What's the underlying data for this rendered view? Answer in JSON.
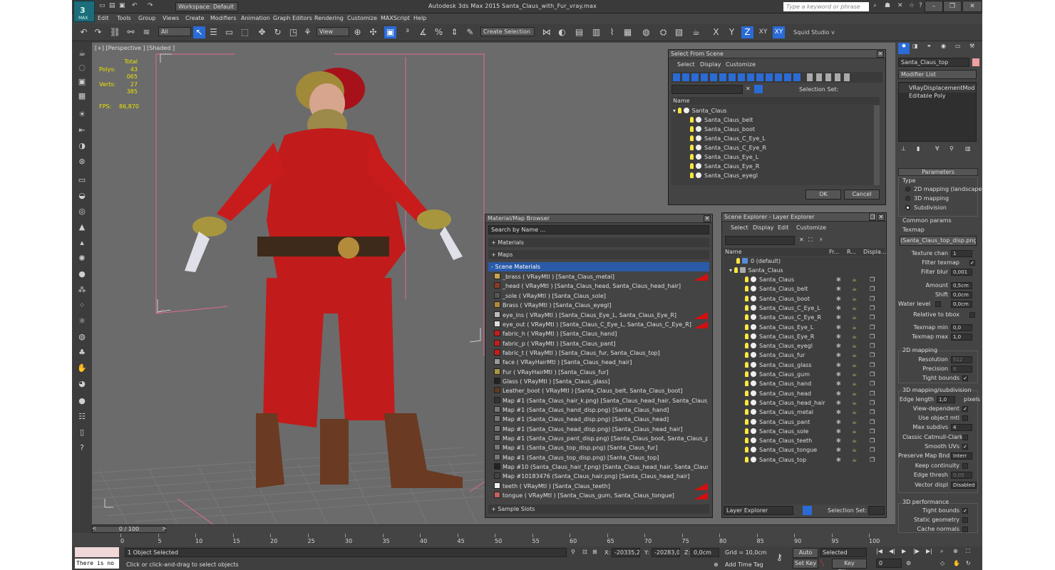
{
  "app": {
    "title": "Autodesk 3ds Max  2015     Santa_Claus_with_Fur_vray.max",
    "logo": "MAX",
    "workspace": "Workspace: Default",
    "search_placeholder": "Type a keyword or phrase",
    "brand_color": "#1d6c7a",
    "accent": "#2a6bd6"
  },
  "menu": [
    "Edit",
    "Tools",
    "Group",
    "Views",
    "Create",
    "Modifiers",
    "Animation",
    "Graph Editors",
    "Rendering",
    "Customize",
    "MAXScript",
    "Help"
  ],
  "toolbar": {
    "filter": "All",
    "refcoord": "View",
    "selection_set": "Create Selection Se",
    "axes": [
      "X",
      "Y",
      "Z",
      "XY",
      "XY"
    ],
    "studio": "Squid Studio v"
  },
  "viewport": {
    "label": "[+] [Perspective ] [Shaded ]",
    "stats": {
      "total_label": "Total",
      "polys_label": "Polys:",
      "polys": "43 065",
      "verts_label": "Verts:",
      "verts": "27 385",
      "fps_label": "FPS:",
      "fps": "86,870"
    }
  },
  "select_from_scene": {
    "title": "Select From Scene",
    "menus": [
      "Select",
      "Display",
      "Customize"
    ],
    "selection_set_label": "Selection Set:",
    "col_name": "Name",
    "root": "Santa_Claus",
    "items": [
      "Santa_Claus_belt",
      "Santa_Claus_boot",
      "Santa_Claus_C_Eye_L",
      "Santa_Claus_C_Eye_R",
      "Santa_Claus_Eye_L",
      "Santa_Claus_Eye_R",
      "Santa_Claus_eyegl"
    ],
    "ok": "OK",
    "cancel": "Cancel"
  },
  "material_browser": {
    "title": "Material/Map Browser",
    "search": "Search by Name ...",
    "sections": {
      "materials": "+ Materials",
      "maps": "+ Maps",
      "scene": "- Scene Materials",
      "slots": "+ Sample Slots"
    },
    "items": [
      {
        "text": "_brass  ( VRayMtl ) [Santa_Claus_metal]",
        "red": true
      },
      {
        "text": "_head  ( VRayMtl ) [Santa_Claus_head, Santa_Claus_head_hair]",
        "red": false
      },
      {
        "text": "_sole  ( VRayMtl ) [Santa_Claus_sole]",
        "red": false
      },
      {
        "text": "Brass  ( VRayMtl ) [Santa_Claus_eyegl]",
        "red": false
      },
      {
        "text": "eye_ins  ( VRayMtl ) [Santa_Claus_Eye_L, Santa_Claus_Eye_R]",
        "red": true
      },
      {
        "text": "eye_out  ( VRayMtl ) [Santa_Claus_C_Eye_L, Santa_Claus_C_Eye_R]",
        "red": true
      },
      {
        "text": "fabric_h  ( VRayMtl ) [Santa_Claus_hand]",
        "red": false
      },
      {
        "text": "fabric_p  ( VRayMtl ) [Santa_Claus_pant]",
        "red": false
      },
      {
        "text": "fabric_t  ( VRayMtl ) [Santa_Claus_fur, Santa_Claus_top]",
        "red": false
      },
      {
        "text": "face  ( VRayHairMtl ) [Santa_Claus_head_hair]",
        "red": false
      },
      {
        "text": "Fur  ( VRayHairMtl ) [Santa_Claus_fur]",
        "red": false
      },
      {
        "text": "Glass  ( VRayMtl ) [Santa_Claus_glass]",
        "red": false
      },
      {
        "text": "Leather_boot  ( VRayMtl ) [Santa_Claus_belt, Santa_Claus_boot]",
        "red": false
      },
      {
        "text": "Map #1 (Santa_Claus_hair_k.png) [Santa_Claus_head_hair, Santa_Claus_head_...",
        "red": false
      },
      {
        "text": "Map #1 (Santa_Claus_hand_disp.png) [Santa_Claus_hand]",
        "red": false
      },
      {
        "text": "Map #1 (Santa_Claus_head_disp.png) [Santa_Claus_head]",
        "red": false
      },
      {
        "text": "Map #1 (Santa_Claus_head_disp.png) [Santa_Claus_head_hair]",
        "red": false
      },
      {
        "text": "Map #1 (Santa_Claus_pant_disp.png) [Santa_Claus_boot, Santa_Claus_pant]",
        "red": false
      },
      {
        "text": "Map #1 (Santa_Claus_top_disp.png) [Santa_Claus_fur]",
        "red": false
      },
      {
        "text": "Map #1 (Santa_Claus_top_disp.png) [Santa_Claus_top]",
        "red": false
      },
      {
        "text": "Map #10 (Santa_Claus_hair_f.png) [Santa_Claus_head_hair, Santa_Claus_head...",
        "red": false
      },
      {
        "text": "Map #10183476 (Santa_Claus_hair.png) [Santa_Claus_head_hair]",
        "red": false
      },
      {
        "text": "teeth  ( VRayMtl ) [Santa_Claus_teeth]",
        "red": true
      },
      {
        "text": "tongue  ( VRayMtl ) [Santa_Claus_gum, Santa_Claus_tongue]",
        "red": true
      }
    ]
  },
  "scene_explorer": {
    "title": "Scene Explorer - Layer Explorer",
    "menus": [
      "Select",
      "Display",
      "Edit",
      "Customize"
    ],
    "cols": [
      "Name",
      "Fr...",
      "R...",
      "Displa..."
    ],
    "default_layer": "0 (default)",
    "root": "Santa_Claus",
    "items": [
      "Santa_Claus",
      "Santa_Claus_belt",
      "Santa_Claus_boot",
      "Santa_Claus_C_Eye_L",
      "Santa_Claus_C_Eye_R",
      "Santa_Claus_Eye_L",
      "Santa_Claus_Eye_R",
      "Santa_Claus_eyegl",
      "Santa_Claus_fur",
      "Santa_Claus_glass",
      "Santa_Claus_gum",
      "Santa_Claus_hand",
      "Santa_Claus_head",
      "Santa_Claus_head_hair",
      "Santa_Claus_metal",
      "Santa_Claus_pant",
      "Santa_Claus_sole",
      "Santa_Claus_teeth",
      "Santa_Claus_tongue",
      "Santa_Claus_top"
    ],
    "footer_dd": "Layer Explorer",
    "footer_sel": "Selection Set:"
  },
  "command_panel": {
    "object_name": "Santa_Claus_top",
    "modifier_list": "Modifier List",
    "stack": [
      "VRayDisplacementMod",
      "Editable Poly"
    ],
    "parameters": "Parameters",
    "type_label": "Type",
    "types": [
      "2D mapping (landscape)",
      "3D mapping",
      "Subdivision"
    ],
    "common": "Common params",
    "texmap_label": "Texmap",
    "texmap": "(Santa_Claus_top_disp.png)",
    "texture_chan": "Texture chan",
    "texture_chan_v": "1",
    "filter_texmap": "Filter texmap",
    "filter_blur": "Filter blur",
    "filter_blur_v": "0,001",
    "amount": "Amount",
    "amount_v": "0,5cm",
    "shift": "Shift",
    "shift_v": "0,0cm",
    "water": "Water level",
    "water_v": "0,0cm",
    "relbbox": "Relative to bbox",
    "tmin": "Texmap min",
    "tmin_v": "0,0",
    "tmax": "Texmap max",
    "tmax_v": "1,0",
    "map2d": "2D mapping",
    "res": "Resolution",
    "res_v": "512",
    "prec": "Precision",
    "prec_v": "8",
    "tight": "Tight bounds",
    "map3d": "3D mapping/subdivision",
    "edge": "Edge length",
    "edge_v": "1,0",
    "pixels": "pixels",
    "viewdep": "View-dependent",
    "useobj": "Use object mtl",
    "maxsub": "Max subdivs",
    "maxsub_v": "4",
    "catmull": "Classic Catmull-Clark",
    "smooth": "Smooth UVs",
    "pmb": "Preserve Map Bnd",
    "pmb_v": "Interr",
    "keepcont": "Keep continuity",
    "edgeth": "Edge thresh",
    "edgeth_v": "0,05",
    "vecdisp": "Vector displ",
    "vecdisp_v": "Disabled",
    "perf": "3D performance",
    "tight2": "Tight bounds",
    "static": "Static geometry",
    "cache": "Cache normals"
  },
  "timeline": {
    "frame": "0 / 100",
    "ticks": [
      "0",
      "5",
      "10",
      "15",
      "20",
      "25",
      "30",
      "35",
      "40",
      "45",
      "50",
      "55",
      "60",
      "65",
      "70",
      "75",
      "80",
      "85",
      "90",
      "95",
      "100"
    ]
  },
  "status": {
    "script": "There is no",
    "selected": "1 Object Selected",
    "hint": "Click or click-and-drag to select objects",
    "x_label": "X:",
    "x": "-20335,256",
    "y_label": "Y:",
    "y": "-20283,076",
    "z_label": "Z:",
    "z": "0,0cm",
    "grid": "Grid = 10,0cm",
    "addtime": "Add Time Tag",
    "autokey": "Auto Key",
    "setkey": "Set Key",
    "selected_dd": "Selected",
    "keyfilters": "Key Filters...",
    "frame_v": "0"
  }
}
